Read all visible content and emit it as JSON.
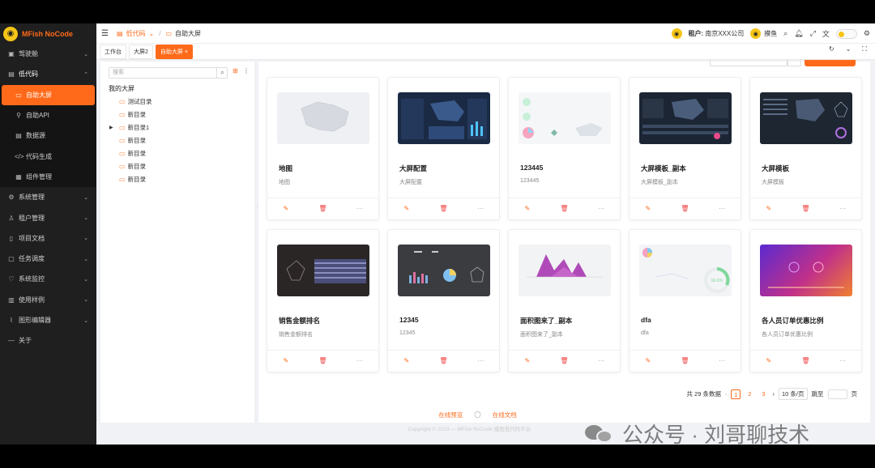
{
  "app": {
    "logo_text": "MFish NoCode"
  },
  "sidebar": {
    "items": [
      {
        "label": "驾驶舱",
        "icon": "dashboard-icon",
        "glyph": "▣",
        "chevron": "⌄"
      },
      {
        "label": "低代码",
        "icon": "code-icon",
        "glyph": "▤",
        "chevron": "⌃"
      },
      {
        "label": "系统管理",
        "icon": "gear-icon",
        "glyph": "⚙",
        "chevron": "⌄"
      },
      {
        "label": "租户管理",
        "icon": "user-icon",
        "glyph": "♙",
        "chevron": "⌄"
      },
      {
        "label": "项目文档",
        "icon": "book-icon",
        "glyph": "▯",
        "chevron": "⌄"
      },
      {
        "label": "任务调度",
        "icon": "task-icon",
        "glyph": "▢",
        "chevron": "⌄"
      },
      {
        "label": "系统监控",
        "icon": "monitor-icon",
        "glyph": "♡",
        "chevron": "⌄"
      },
      {
        "label": "使用样例",
        "icon": "sample-icon",
        "glyph": "▥",
        "chevron": "⌄"
      },
      {
        "label": "图形编辑器",
        "icon": "chart-icon",
        "glyph": "⌇",
        "chevron": "⌄"
      },
      {
        "label": "关于",
        "icon": "about-icon",
        "glyph": "—",
        "chevron": ""
      }
    ],
    "submenu": [
      {
        "label": "自助大屏",
        "icon": "screen-icon",
        "glyph": "▭"
      },
      {
        "label": "自助API",
        "icon": "link-icon",
        "glyph": "⚲"
      },
      {
        "label": "数据源",
        "icon": "database-icon",
        "glyph": "▤"
      },
      {
        "label": "代码生成",
        "icon": "code-gen-icon",
        "glyph": "</>"
      },
      {
        "label": "组件管理",
        "icon": "component-icon",
        "glyph": "▦"
      }
    ]
  },
  "header": {
    "breadcrumb": [
      "低代码",
      "自助大屏"
    ],
    "tenant_label": "租户:",
    "tenant_name": "南京XXX公司",
    "user_name": "摸鱼"
  },
  "tabs": [
    "工作台",
    "大屏2",
    "自助大屏 ×"
  ],
  "tree": {
    "search_placeholder": "搜索",
    "root": "我的大屏",
    "nodes": [
      "测试目录",
      "新目录",
      "新目录1",
      "新目录",
      "新目录",
      "新目录",
      "新目录"
    ]
  },
  "cards": [
    {
      "title": "地图",
      "desc": "地图"
    },
    {
      "title": "大屏配置",
      "desc": "大屏配置"
    },
    {
      "title": "123445",
      "desc": "123445"
    },
    {
      "title": "大屏模板_副本",
      "desc": "大屏模板_副本"
    },
    {
      "title": "大屏模板",
      "desc": "大屏模板"
    },
    {
      "title": "销售金额排名",
      "desc": "销售金额排名"
    },
    {
      "title": "12345",
      "desc": "12345"
    },
    {
      "title": "面积图来了_副本",
      "desc": "面积图来了_副本"
    },
    {
      "title": "dfa",
      "desc": "dfa"
    },
    {
      "title": "各人员订单优惠比例",
      "desc": "各人员订单优惠比例"
    }
  ],
  "card_actions": {
    "edit": "✎",
    "delete": "🗑",
    "more": "···"
  },
  "pagination": {
    "total_text": "共 29 条数据",
    "pages": [
      "1",
      "2",
      "3"
    ],
    "current": "1",
    "page_size": "10 条/页",
    "jump_label": "跳至",
    "page_suffix": "页"
  },
  "footer": {
    "preview": "在线预览",
    "docs": "在线文档",
    "copyright": "Copyright © 2023 — MFish NoCode 摸鱼低代码平台"
  },
  "watermark": "公众号 · 刘哥聊技术",
  "colors": {
    "accent": "#ff6a1a",
    "sidebar_bg": "#1f1f1f"
  }
}
